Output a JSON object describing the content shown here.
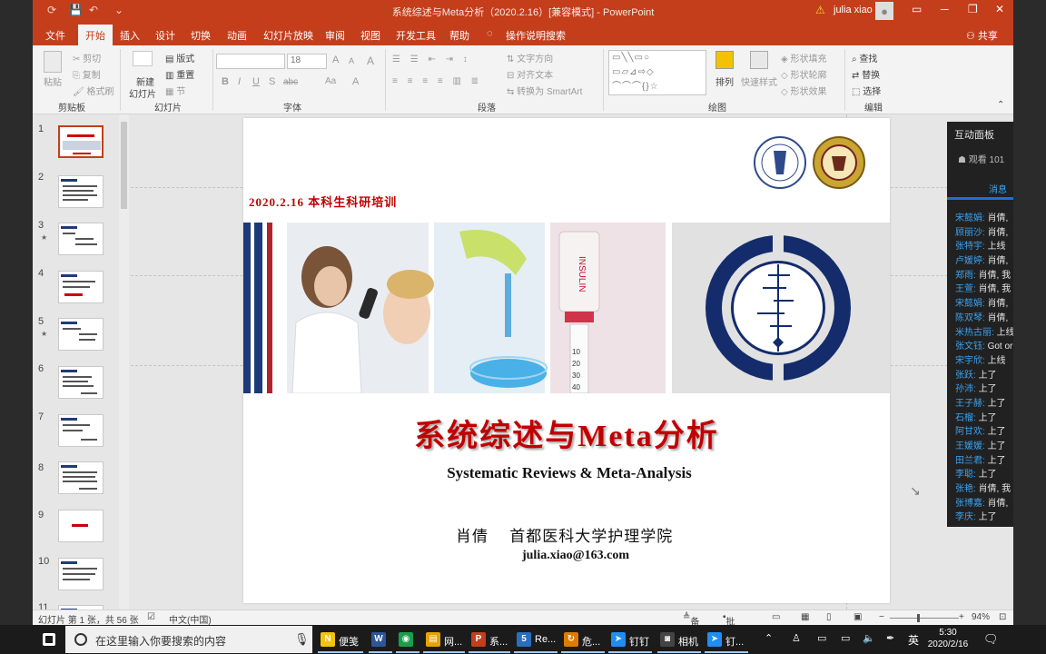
{
  "window": {
    "title": "系统综述与Meta分析（2020.2.16）[兼容模式] - PowerPoint",
    "user": "julia xiao",
    "warning_glyph": "⚠",
    "quick_access": [
      "⟳",
      "💾",
      "↶",
      "⌄"
    ],
    "controls": [
      "▭",
      "─",
      "❐",
      "✕"
    ]
  },
  "tabs": [
    "文件",
    "开始",
    "插入",
    "设计",
    "切换",
    "动画",
    "幻灯片放映",
    "审阅",
    "视图",
    "开发工具",
    "帮助",
    "操作说明搜索"
  ],
  "active_tab": "开始",
  "share": "共享",
  "ribbon": {
    "groups": [
      "剪贴板",
      "幻灯片",
      "字体",
      "段落",
      "绘图",
      "编辑"
    ],
    "clipboard": {
      "paste": "粘贴",
      "cut": "剪切",
      "copy": "复制",
      "format_painter": "格式刷"
    },
    "slides": {
      "new_slide": "新建",
      "new_slide_2": "幻灯片",
      "layout": "版式",
      "reset": "重置",
      "section": "节"
    },
    "font": {
      "size": "18",
      "bold": "B",
      "italic": "I",
      "underline": "U",
      "strike": "S",
      "spacing": "abc",
      "case": "Aa",
      "grow": "A",
      "shrink": "A",
      "clear": "A"
    },
    "paragraph": {
      "text_direction": "文字方向",
      "align_text": "对齐文本",
      "smartart": "转换为 SmartArt"
    },
    "drawing": {
      "arrange": "排列",
      "quick_styles": "快速样式",
      "shape_fill": "形状填充",
      "shape_outline": "形状轮廓",
      "shape_effects": "形状效果",
      "shapes_preview": "▭╲╲▭○\n▭▱⊿⇨◇\n⌒⌒⌒{}☆"
    },
    "editing": {
      "find": "查找",
      "replace": "替换",
      "select": "选择"
    }
  },
  "thumbnails": {
    "numbers": [
      "1",
      "2",
      "3",
      "4",
      "5",
      "6",
      "7",
      "8",
      "9",
      "10",
      "11"
    ],
    "selected": 0,
    "stars": [
      3,
      5
    ]
  },
  "slide": {
    "date_line": "2020.2.16 本科生科研培训",
    "title": "系统综述与Meta分析",
    "subtitle": "Systematic Reviews & Meta-Analysis",
    "author": "肖倩　 首都医科大学护理学院",
    "email": "julia.xiao@163.com",
    "vial_label": "INSULIN",
    "syringe_marks": [
      "10",
      "20",
      "30",
      "40"
    ]
  },
  "panel": {
    "title": "互动面板",
    "viewers": "观看 101",
    "tab": "消息",
    "messages": [
      {
        "name": "宋懿娟:",
        "text": "肖倩,"
      },
      {
        "name": "顾丽沙:",
        "text": "肖倩,"
      },
      {
        "name": "张特宇:",
        "text": "上线"
      },
      {
        "name": "卢媛婷:",
        "text": "肖倩,"
      },
      {
        "name": "郑雨:",
        "text": "肖倩, 我"
      },
      {
        "name": "王萱:",
        "text": "肖倩, 我"
      },
      {
        "name": "宋懿娟:",
        "text": "肖倩,"
      },
      {
        "name": "陈双琴:",
        "text": "肖倩,"
      },
      {
        "name": "米热古丽:",
        "text": "上线"
      },
      {
        "name": "张文钰:",
        "text": "Got or"
      },
      {
        "name": "宋宇欣:",
        "text": "上线"
      },
      {
        "name": "张跃:",
        "text": "上了"
      },
      {
        "name": "孙沛:",
        "text": "上了"
      },
      {
        "name": "王子赫:",
        "text": "上了"
      },
      {
        "name": "石榴:",
        "text": "上了"
      },
      {
        "name": "阿甘欢:",
        "text": "上了"
      },
      {
        "name": "王媛媛:",
        "text": "上了"
      },
      {
        "name": "田兰君:",
        "text": "上了"
      },
      {
        "name": "李聪:",
        "text": "上了"
      },
      {
        "name": "张艳:",
        "text": "肖倩, 我"
      },
      {
        "name": "张博嘉:",
        "text": "肖倩,"
      },
      {
        "name": "李庆:",
        "text": "上了"
      }
    ]
  },
  "status": {
    "slide_info": "幻灯片 第 1 张，共 56 张",
    "language": "中文(中国)",
    "notes": "备注",
    "comments": "批注",
    "zoom": "94%",
    "minus": "−",
    "plus": "+"
  },
  "taskbar": {
    "search_placeholder": "在这里输入你要搜索的内容",
    "apps": [
      {
        "label": "便笺",
        "icon": "N",
        "color": "#f4c20d"
      },
      {
        "label": "",
        "icon": "W",
        "color": "#2b579a"
      },
      {
        "label": "",
        "icon": "◉",
        "color": "#1a9e4b"
      },
      {
        "label": "网...",
        "icon": "▤",
        "color": "#e8a200"
      },
      {
        "label": "系...",
        "icon": "P",
        "color": "#c43e1c"
      },
      {
        "label": "Re...",
        "icon": "5",
        "color": "#2a6ebf"
      },
      {
        "label": "危...",
        "icon": "↻",
        "color": "#e07b00"
      },
      {
        "label": "钉钉",
        "icon": "➤",
        "color": "#1f8df2"
      },
      {
        "label": "相机",
        "icon": "◙",
        "color": "#444444"
      },
      {
        "label": "钉...",
        "icon": "➤",
        "color": "#1f8df2"
      }
    ],
    "ime": "英",
    "time": "5:30",
    "date": "2020/2/16"
  }
}
